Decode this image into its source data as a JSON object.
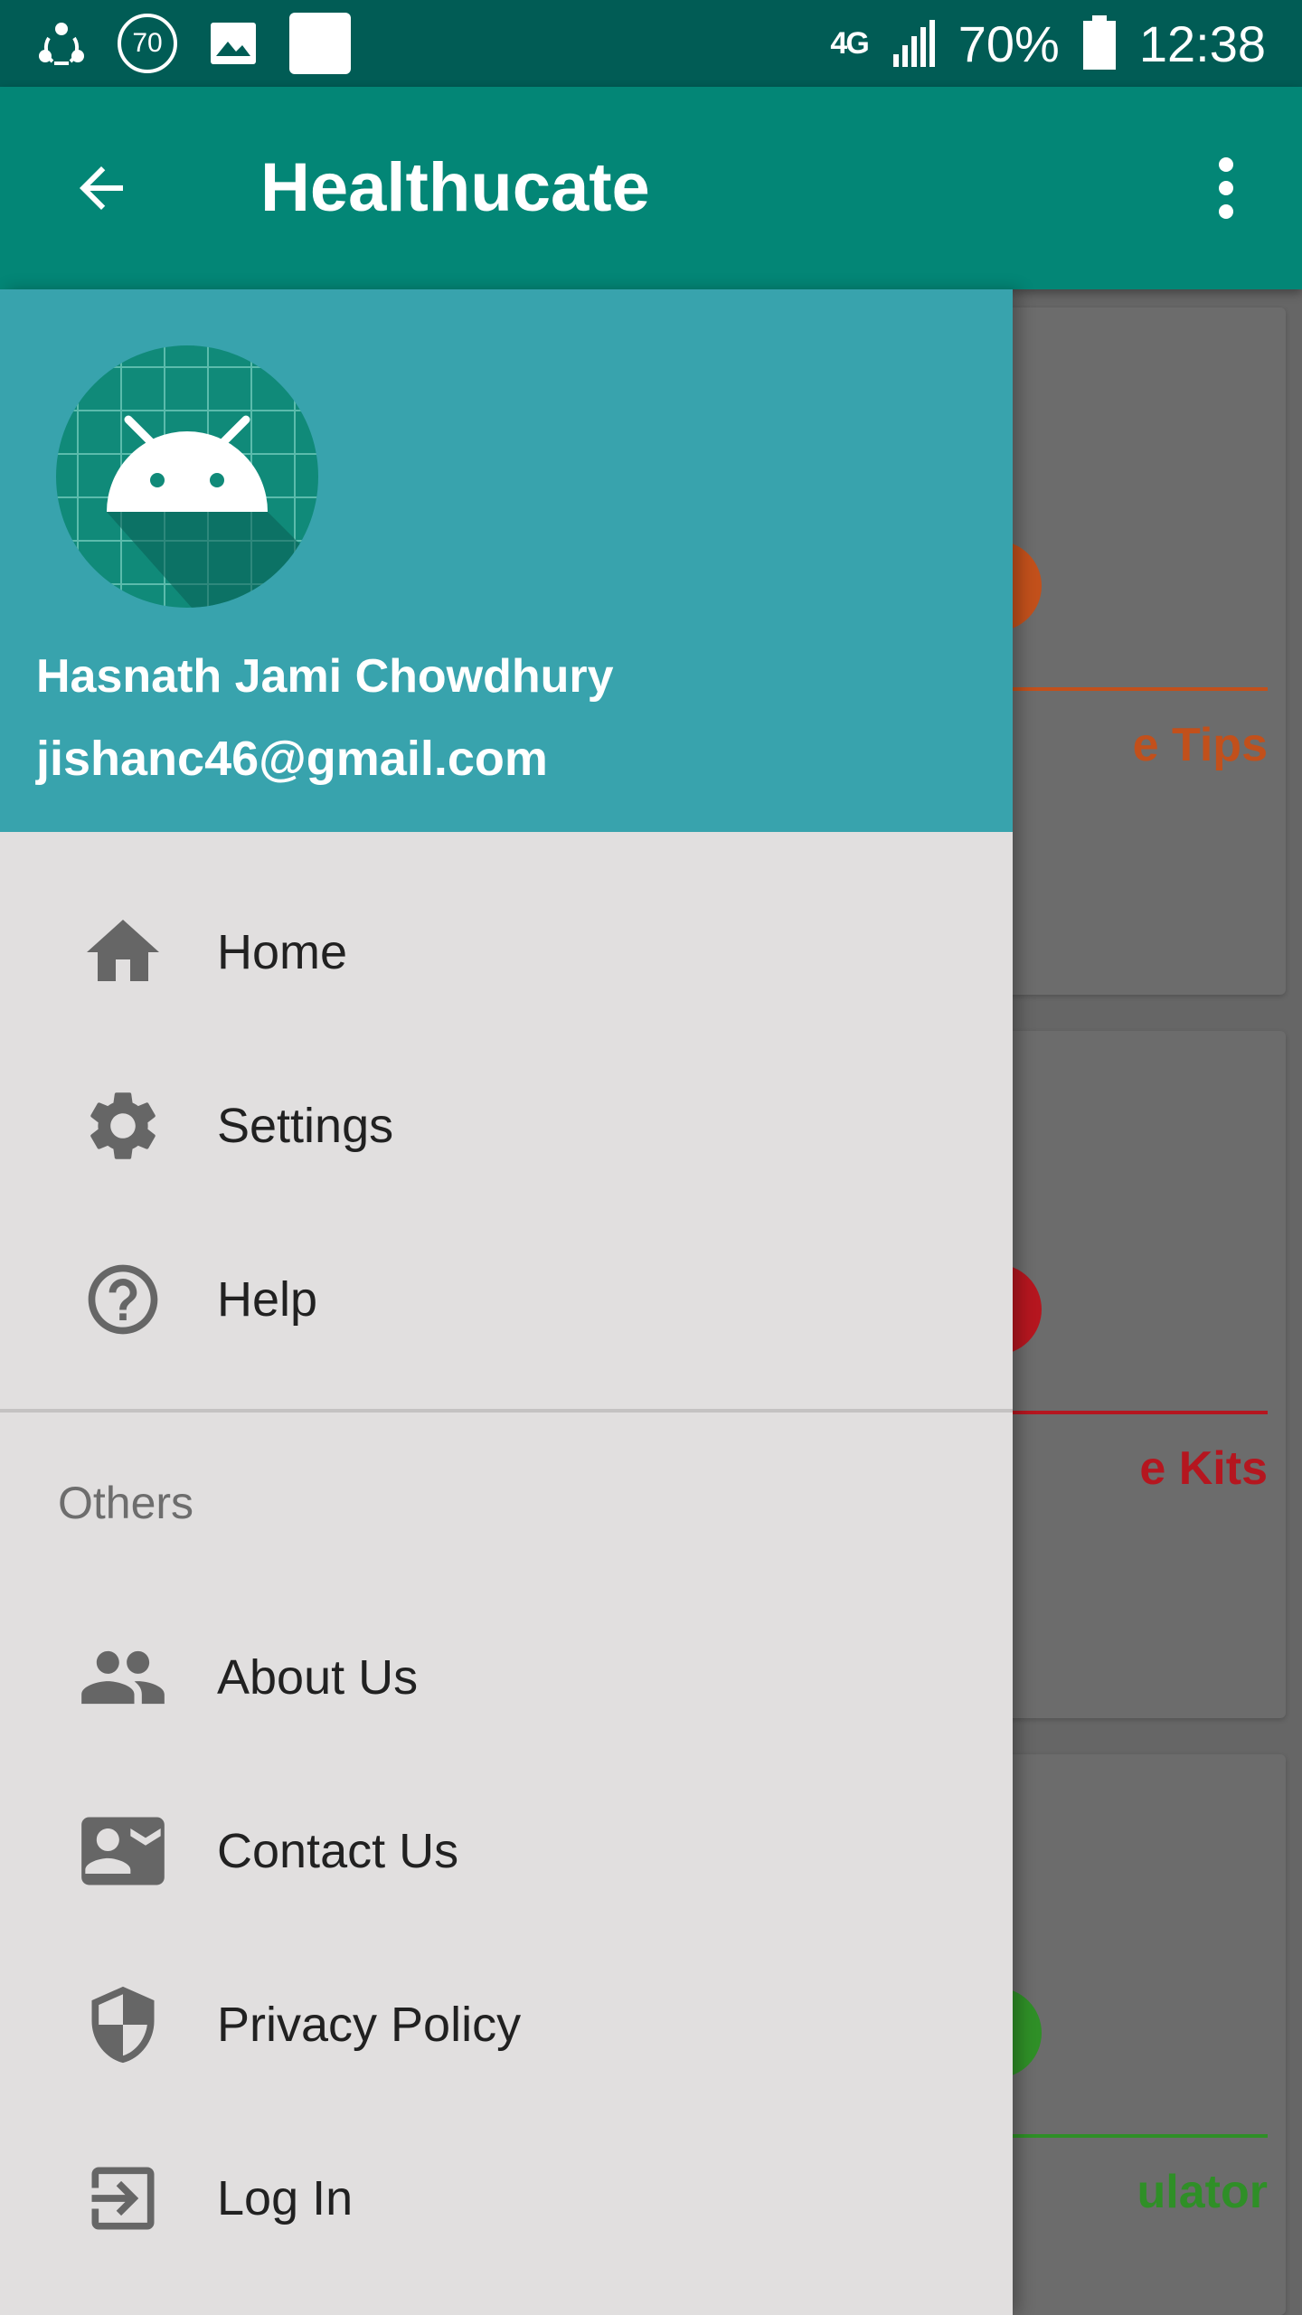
{
  "status_bar": {
    "badge_number": "70",
    "network": "4G",
    "battery": "70%",
    "time": "12:38",
    "icons": [
      "share-icon",
      "badge-icon",
      "image-icon",
      "blank-notification-icon",
      "network-4g-icon",
      "signal-icon",
      "battery-icon"
    ]
  },
  "toolbar": {
    "title": "Healthucate",
    "back_icon": "arrow-back-icon",
    "more_icon": "more-vert-icon"
  },
  "background": {
    "cards": [
      {
        "text": "e Tips",
        "color": "#c2501b"
      },
      {
        "text": "e Kits",
        "color": "#b5161f"
      },
      {
        "text": "ulator",
        "color": "#2f8f27"
      }
    ]
  },
  "drawer": {
    "header": {
      "name": "Hasnath Jami Chowdhury",
      "email": "jishanc46@gmail.com",
      "avatar_icon": "android-avatar-icon",
      "color": "#38a3ad"
    },
    "main_items": [
      {
        "label": "Home",
        "icon": "home-icon"
      },
      {
        "label": "Settings",
        "icon": "gear-icon"
      },
      {
        "label": "Help",
        "icon": "help-icon"
      }
    ],
    "section_title": "Others",
    "other_items": [
      {
        "label": "About Us",
        "icon": "people-icon"
      },
      {
        "label": "Contact Us",
        "icon": "contact-card-icon"
      },
      {
        "label": "Privacy Policy",
        "icon": "shield-icon"
      },
      {
        "label": "Log In",
        "icon": "login-icon"
      }
    ]
  },
  "colors": {
    "status_bar": "#015c55",
    "toolbar": "#038676",
    "drawer_bg": "#e1dfdf",
    "icon_gray": "#666666"
  }
}
